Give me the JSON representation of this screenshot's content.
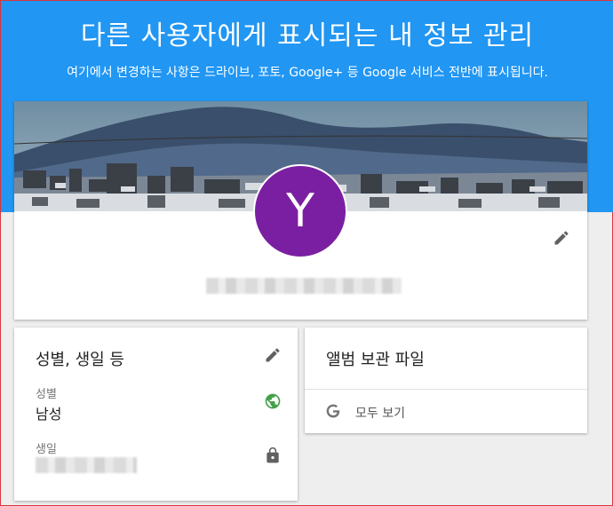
{
  "header": {
    "title": "다른 사용자에게 표시되는 내 정보 관리",
    "subtitle": "여기에서 변경하는 사항은 드라이브, 포토, Google+ 등 Google 서비스 전반에 표시됩니다."
  },
  "profile": {
    "avatar_initial": "Y",
    "avatar_color": "#7b1fa2",
    "name_redacted": ""
  },
  "basic_info": {
    "title": "성별, 생일 등",
    "gender_label": "성별",
    "gender_value": "남성",
    "birthday_label": "생일",
    "birthday_value": ""
  },
  "album_archive": {
    "title": "앨범 보관 파일",
    "view_all_label": "모두 보기"
  },
  "colors": {
    "accent": "#2196f3",
    "globe": "#43a047",
    "icon_grey": "#616161"
  }
}
